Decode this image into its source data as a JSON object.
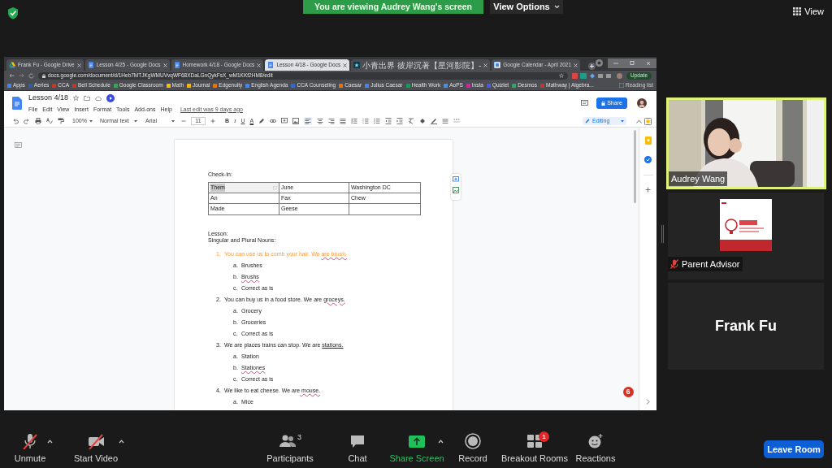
{
  "top_bar": {
    "banner": "You are viewing Audrey Wang's screen",
    "view_options": "View Options",
    "view": "View"
  },
  "browser": {
    "tabs": [
      {
        "title": "Frank Fu - Google Drive",
        "kind": "drive",
        "selected": false
      },
      {
        "title": "Lesson 4/25 - Google Docs",
        "kind": "docs",
        "selected": false
      },
      {
        "title": "Homework 4/18 - Google Docs",
        "kind": "docs",
        "selected": false
      },
      {
        "title": "Lesson 4/18 - Google Docs",
        "kind": "docs",
        "selected": true
      },
      {
        "title": "小青出界 彼岸沉著【星河影院】-",
        "kind": "video",
        "selected": false
      },
      {
        "title": "Google Calendar - April 2021",
        "kind": "calendar",
        "selected": false
      }
    ],
    "url": "docs.google.com/document/d/1Heb7MTJKgWMUVvqWF68XDaLGnQykFsX_wM1KKf2HM8/edit",
    "update": "Update",
    "bookmarks": [
      "Apps",
      "Aeries",
      "CCA",
      "Bell Schedule",
      "Google Classroom",
      "Math",
      "Journal",
      "Edgenuity",
      "English Agenda",
      "CCA Counseling",
      "Caesar",
      "Julius Caesar",
      "Health Work",
      "AoPS",
      "Insta",
      "Quizlet",
      "Desmos",
      "Mathway | Algebra..."
    ],
    "reading_list": "Reading list"
  },
  "doc": {
    "title": "Lesson 4/18",
    "menus": [
      "File",
      "Edit",
      "View",
      "Insert",
      "Format",
      "Tools",
      "Add-ons",
      "Help"
    ],
    "last_edit": "Last edit was 9 days ago",
    "share": "Share",
    "toolbar": {
      "zoom": "100%",
      "style": "Normal text",
      "font": "Arial",
      "size": "11",
      "format": [
        "B",
        "I",
        "U",
        "A"
      ],
      "mode": "Editing"
    },
    "heading": "Check-In:",
    "table": [
      [
        {
          "text": "Them",
          "selected": true
        },
        {
          "text": "June",
          "selected": false
        },
        {
          "text": "Washington DC",
          "selected": false
        }
      ],
      [
        {
          "text": "An",
          "selected": false
        },
        {
          "text": "Fax",
          "selected": false
        },
        {
          "text": "Chew",
          "selected": false
        }
      ],
      [
        {
          "text": "Made",
          "selected": false
        },
        {
          "text": "Geese",
          "selected": false
        }
      ]
    ],
    "label": "Lesson:",
    "subtitle": "Singular and Plural Nouns:",
    "questions": [
      {
        "number": "1.",
        "text": "You can use us to comb your hair. We ",
        "answer": "are brush.",
        "flagged": true,
        "highlighted": true,
        "options": [
          {
            "letter": "a.",
            "text": "Brushes",
            "flagged": false
          },
          {
            "letter": "b.",
            "text": "Brushs",
            "flagged": true
          },
          {
            "letter": "c.",
            "text": "Correct as is",
            "flagged": false
          }
        ]
      },
      {
        "number": "2.",
        "text": "You can buy us in a food store. We are ",
        "answer": "groceys.",
        "flagged": true,
        "highlighted": false,
        "options": [
          {
            "letter": "a.",
            "text": "Grocery",
            "flagged": false
          },
          {
            "letter": "b.",
            "text": "Groceries",
            "flagged": false
          },
          {
            "letter": "c.",
            "text": "Correct as is",
            "flagged": false
          }
        ]
      },
      {
        "number": "3.",
        "text": "We are places trains can stop. We are ",
        "answer": "stations.",
        "flagged": false,
        "highlighted": false,
        "options": [
          {
            "letter": "a.",
            "text": "Station",
            "flagged": false
          },
          {
            "letter": "b.",
            "text": "Stationes",
            "flagged": true
          },
          {
            "letter": "c.",
            "text": "Correct as is",
            "flagged": false
          }
        ]
      },
      {
        "number": "4.",
        "text": "We like to eat cheese. We are",
        "answer": " mouse.",
        "flagged": true,
        "highlighted": false,
        "options": [
          {
            "letter": "a.",
            "text": "Mice",
            "flagged": false
          }
        ]
      }
    ],
    "notifications": "6"
  },
  "participants": [
    {
      "name": "Audrey Wang",
      "kind": "video",
      "speaking": true
    },
    {
      "name": "Parent Advisor",
      "kind": "logo",
      "speaking": false,
      "muted": true
    },
    {
      "name": "Frank Fu",
      "kind": "name",
      "speaking": false
    }
  ],
  "controls": [
    {
      "kind": "mic",
      "label": "Unmute",
      "off": true,
      "menu": true
    },
    {
      "kind": "video",
      "label": "Start Video",
      "off": true,
      "menu": true
    },
    {
      "kind": "people",
      "label": "Participants",
      "count": "3",
      "off": false,
      "menu": false
    },
    {
      "kind": "chat",
      "label": "Chat",
      "off": false,
      "menu": false
    },
    {
      "kind": "share",
      "label": "Share Screen",
      "off": false,
      "menu": true
    },
    {
      "kind": "record",
      "label": "Record",
      "off": false,
      "menu": false
    },
    {
      "kind": "rooms",
      "label": "Breakout Rooms",
      "badge": "1",
      "off": false,
      "menu": false
    },
    {
      "kind": "react",
      "label": "Reactions",
      "off": false,
      "menu": false
    }
  ],
  "leave": "Leave Room"
}
